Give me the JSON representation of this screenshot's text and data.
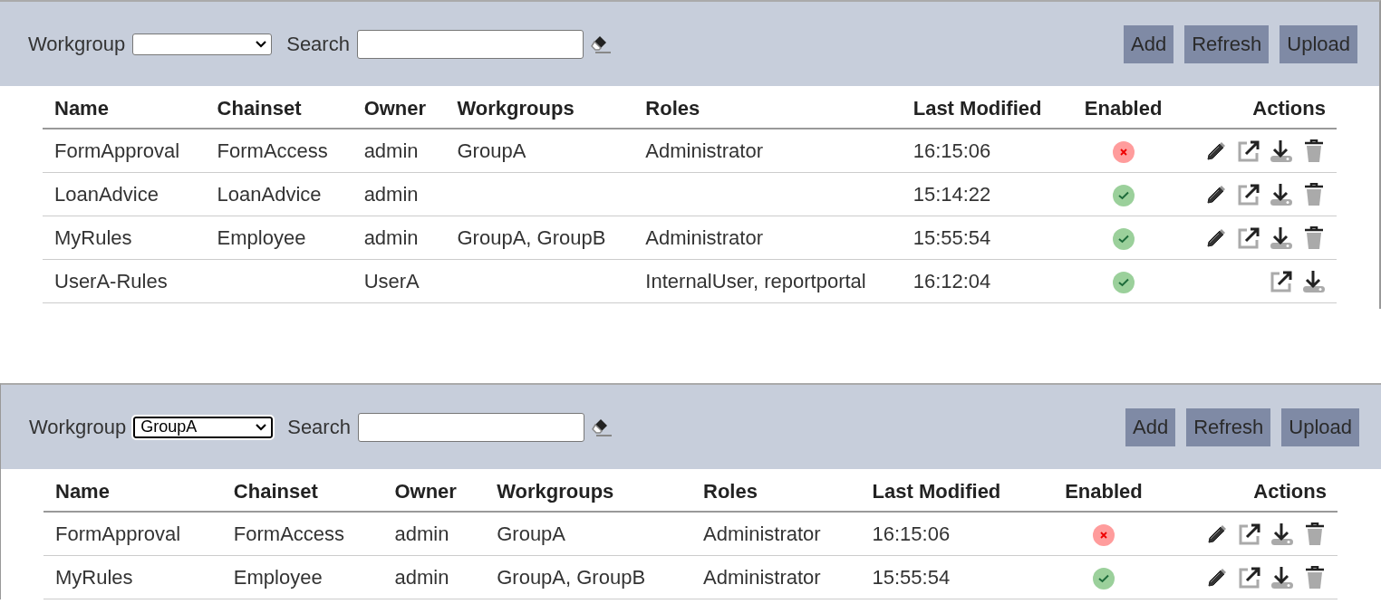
{
  "panels": [
    {
      "toolbar": {
        "workgroup_label": "Workgroup",
        "workgroup_focused": false,
        "search_label": "Search",
        "buttons": [
          "Add",
          "Refresh",
          "Upload"
        ]
      },
      "table": {
        "columns": [
          "Name",
          "Chainset",
          "Owner",
          "Workgroups",
          "Roles",
          "Last Modified",
          "Enabled",
          "Actions"
        ],
        "rows": [
          {
            "name": "FormApproval",
            "chainset": "FormAccess",
            "owner": "admin",
            "workgroups": "GroupA",
            "roles": "Administrator",
            "last_modified": "16:15:06",
            "enabled": false,
            "can_edit": true,
            "can_delete": true
          },
          {
            "name": "LoanAdvice",
            "chainset": "LoanAdvice",
            "owner": "admin",
            "workgroups": "",
            "roles": "",
            "last_modified": "15:14:22",
            "enabled": true,
            "can_edit": true,
            "can_delete": true
          },
          {
            "name": "MyRules",
            "chainset": "Employee",
            "owner": "admin",
            "workgroups": "GroupA, GroupB",
            "roles": "Administrator",
            "last_modified": "15:55:54",
            "enabled": true,
            "can_edit": true,
            "can_delete": true
          },
          {
            "name": "UserA-Rules",
            "chainset": "",
            "owner": "UserA",
            "workgroups": "",
            "roles": "InternalUser, reportportal",
            "last_modified": "16:12:04",
            "enabled": true,
            "can_edit": false,
            "can_delete": false
          }
        ]
      }
    },
    {
      "toolbar": {
        "workgroup_label": "Workgroup",
        "workgroup_value": "GroupA",
        "workgroup_focused": true,
        "search_label": "Search",
        "buttons": [
          "Add",
          "Refresh",
          "Upload"
        ]
      },
      "table": {
        "columns": [
          "Name",
          "Chainset",
          "Owner",
          "Workgroups",
          "Roles",
          "Last Modified",
          "Enabled",
          "Actions"
        ],
        "rows": [
          {
            "name": "FormApproval",
            "chainset": "FormAccess",
            "owner": "admin",
            "workgroups": "GroupA",
            "roles": "Administrator",
            "last_modified": "16:15:06",
            "enabled": false,
            "can_edit": true,
            "can_delete": true
          },
          {
            "name": "MyRules",
            "chainset": "Employee",
            "owner": "admin",
            "workgroups": "GroupA, GroupB",
            "roles": "Administrator",
            "last_modified": "15:55:54",
            "enabled": true,
            "can_edit": true,
            "can_delete": true
          }
        ]
      }
    }
  ]
}
